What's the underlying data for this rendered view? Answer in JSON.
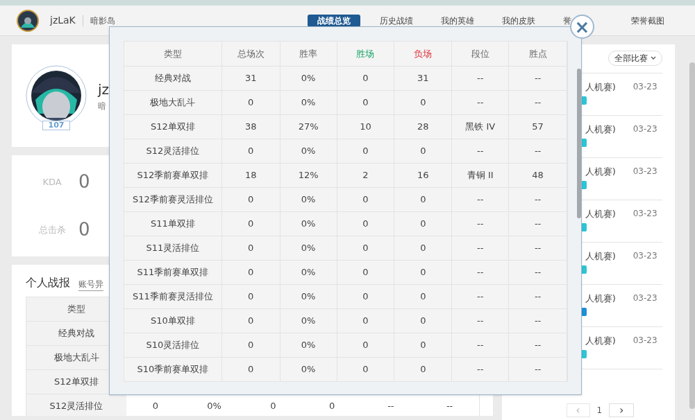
{
  "header": {
    "username": "jzLaK",
    "server": "暗影岛",
    "tabs": [
      {
        "label": "战绩总览",
        "selected": true
      },
      {
        "label": "历史战绩",
        "selected": false
      },
      {
        "label": "我的英雄",
        "selected": false
      },
      {
        "label": "我的皮肤",
        "selected": false
      },
      {
        "label": "誉",
        "selected": false
      },
      {
        "label": "荣誉截图",
        "selected": false
      }
    ]
  },
  "profile": {
    "name": "jz",
    "server": "暗",
    "level": "107"
  },
  "stats": [
    {
      "label": "KDA",
      "value": "0"
    },
    {
      "label": "总击杀",
      "value": "0"
    }
  ],
  "report": {
    "title": "个人战报",
    "link": "账号异",
    "columns": [
      "类型"
    ],
    "rows": [
      [
        "经典对战"
      ],
      [
        "极地大乱斗"
      ],
      [
        "S12单双排"
      ],
      [
        "S12灵活排位",
        "0",
        "0%",
        "0",
        "0",
        "--",
        "--"
      ]
    ]
  },
  "matches": {
    "filter": "全部比赛",
    "items": [
      {
        "mode": "人机赛)",
        "date": "03-23",
        "color": "#2ec4d6"
      },
      {
        "mode": "人机赛)",
        "date": "03-23",
        "color": "#2ec4d6"
      },
      {
        "mode": "人机赛)",
        "date": "03-23",
        "color": "#2ec4d6"
      },
      {
        "mode": "人机赛)",
        "date": "03-23",
        "color": "#2ec4d6"
      },
      {
        "mode": "人机赛)",
        "date": "03-23",
        "color": "#2ec4d6"
      },
      {
        "mode": "人机赛)",
        "date": "03-23",
        "color": "#1e8fd8"
      },
      {
        "mode": "人机赛)",
        "date": "03-23",
        "color": "#2ec4d6"
      }
    ],
    "pagination": {
      "prev": "‹",
      "page": "1",
      "next": "›"
    }
  },
  "modal": {
    "close": "×",
    "columns": [
      {
        "label": "类型",
        "kind": "plain"
      },
      {
        "label": "总场次",
        "kind": "plain"
      },
      {
        "label": "胜率",
        "kind": "plain"
      },
      {
        "label": "胜场",
        "kind": "win"
      },
      {
        "label": "负场",
        "kind": "loss"
      },
      {
        "label": "段位",
        "kind": "plain"
      },
      {
        "label": "胜点",
        "kind": "plain"
      }
    ],
    "rows": [
      [
        "经典对战",
        "31",
        "0%",
        "0",
        "31",
        "--",
        "--"
      ],
      [
        "极地大乱斗",
        "0",
        "0%",
        "0",
        "0",
        "--",
        "--"
      ],
      [
        "S12单双排",
        "38",
        "27%",
        "10",
        "28",
        "黑铁 IV",
        "57"
      ],
      [
        "S12灵活排位",
        "0",
        "0%",
        "0",
        "0",
        "--",
        "--"
      ],
      [
        "S12季前赛单双排",
        "18",
        "12%",
        "2",
        "16",
        "青铜 II",
        "48"
      ],
      [
        "S12季前赛灵活排位",
        "0",
        "0%",
        "0",
        "0",
        "--",
        "--"
      ],
      [
        "S11单双排",
        "0",
        "0%",
        "0",
        "0",
        "--",
        "--"
      ],
      [
        "S11灵活排位",
        "0",
        "0%",
        "0",
        "0",
        "--",
        "--"
      ],
      [
        "S11季前赛单双排",
        "0",
        "0%",
        "0",
        "0",
        "--",
        "--"
      ],
      [
        "S11季前赛灵活排位",
        "0",
        "0%",
        "0",
        "0",
        "--",
        "--"
      ],
      [
        "S10单双排",
        "0",
        "0%",
        "0",
        "0",
        "--",
        "--"
      ],
      [
        "S10灵活排位",
        "0",
        "0%",
        "0",
        "0",
        "--",
        "--"
      ],
      [
        "S10季前赛单双排",
        "0",
        "0%",
        "0",
        "0",
        "--",
        "--"
      ]
    ]
  }
}
